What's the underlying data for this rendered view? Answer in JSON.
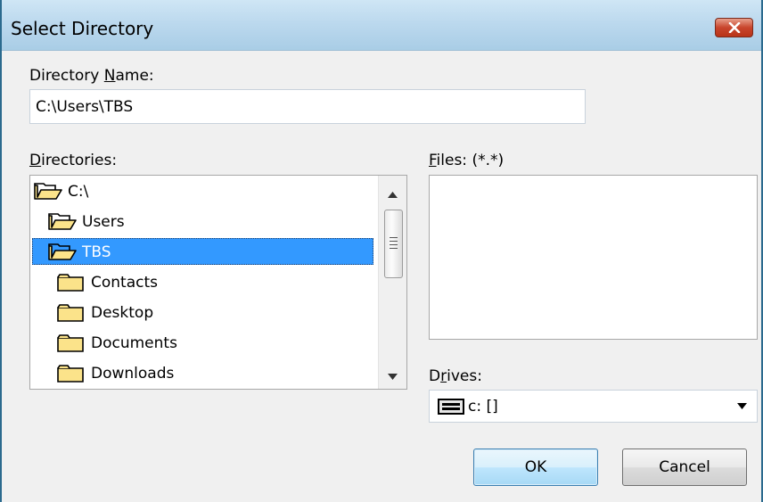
{
  "window": {
    "title": "Select Directory",
    "close_icon": "close-x-icon"
  },
  "directory_name": {
    "label_prefix": "Directory ",
    "label_mnemonic": "N",
    "label_suffix": "ame:",
    "value": "C:\\Users\\TBS"
  },
  "directories": {
    "label_mnemonic": "D",
    "label_suffix": "irectories:",
    "items": [
      {
        "name": "C:\\",
        "icon": "open-folder-icon",
        "level": 0,
        "selected": false
      },
      {
        "name": "Users",
        "icon": "open-folder-icon",
        "level": 1,
        "selected": false
      },
      {
        "name": "TBS",
        "icon": "open-folder-icon",
        "level": 1,
        "selected": true
      },
      {
        "name": "Contacts",
        "icon": "closed-folder-icon",
        "level": 2,
        "selected": false
      },
      {
        "name": "Desktop",
        "icon": "closed-folder-icon",
        "level": 2,
        "selected": false
      },
      {
        "name": "Documents",
        "icon": "closed-folder-icon",
        "level": 2,
        "selected": false
      },
      {
        "name": "Downloads",
        "icon": "closed-folder-icon",
        "level": 2,
        "selected": false
      }
    ]
  },
  "files": {
    "label_mnemonic": "F",
    "label_suffix": "iles: (*.*)"
  },
  "drives": {
    "label_prefix": "D",
    "label_mnemonic": "r",
    "label_suffix": "ives:",
    "value": "c: []",
    "icon": "drive-icon"
  },
  "buttons": {
    "ok": "OK",
    "cancel": "Cancel"
  },
  "colors": {
    "selection": "#3399ff",
    "titlebar": "#bcd9ee",
    "close_button": "#c8452c"
  }
}
